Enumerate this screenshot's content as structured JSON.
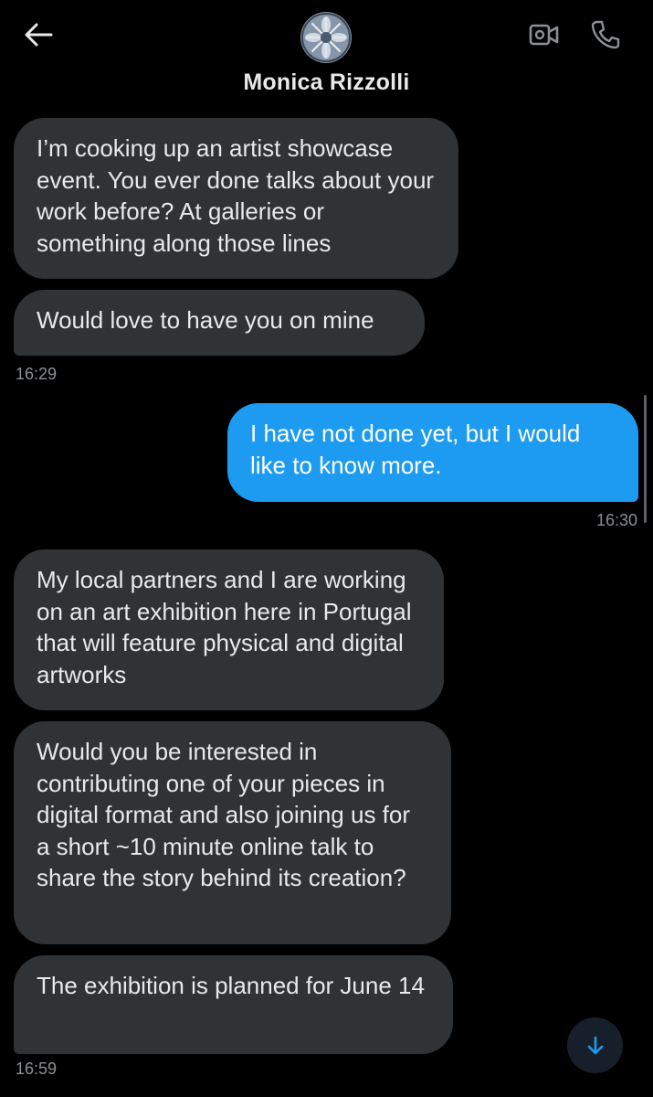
{
  "header": {
    "contact_name": "Monica Rizzolli",
    "back_icon": "arrow-left-icon",
    "video_icon": "video-camera-icon",
    "call_icon": "phone-icon"
  },
  "messages": [
    {
      "direction": "incoming",
      "text": "I’m cooking up an artist showcase event. You ever done talks about your work before? At galleries or something along those lines"
    },
    {
      "direction": "incoming",
      "text": "Would love to have you on mine",
      "time": "16:29"
    },
    {
      "direction": "outgoing",
      "text": "I have not done yet, but I would like to know more.",
      "time": "16:30"
    },
    {
      "direction": "incoming",
      "text": "My local partners and I are working on an art exhibition here in Portugal that will feature physical and digital artworks"
    },
    {
      "direction": "incoming",
      "text": "Would you be interested in contributing one of your pieces in digital format and also joining us for a short ~10 minute online talk to share the story behind its creation?"
    },
    {
      "direction": "incoming",
      "text": "The exhibition is planned for June 14",
      "time": "16:59"
    }
  ],
  "scroll_down_icon": "arrow-down-icon",
  "colors": {
    "background": "#000000",
    "incoming_bubble": "#2f3336",
    "outgoing_bubble": "#1d9bf0",
    "timestamp": "#8b9095",
    "accent": "#1d9bf0"
  }
}
